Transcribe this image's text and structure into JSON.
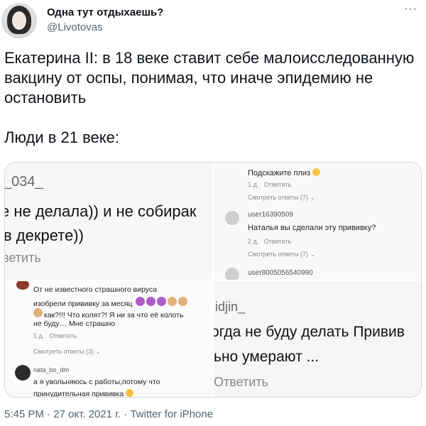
{
  "author": {
    "display_name": "Одна тут отдыхаешь?",
    "handle": "@Livotovas",
    "avatar_icon": "avatar-portrait"
  },
  "more_icon": "···",
  "tweet": {
    "paragraph1": "Екатерина II: в 18 веке ставит себе малоисследованную вакцину от оспы, понимая, что иначе эпидемию не остановить",
    "paragraph2": "Люди в 21 веке:"
  },
  "media": {
    "top_left": {
      "line1": "_034_",
      "line2": "е не делала)) и не собирак",
      "line3": "в декрете))",
      "line4": "ветить"
    },
    "top_right": {
      "comment1": "Подскажите плиз",
      "meta1_age": "1 д.",
      "meta1_reply": "Ответить",
      "view1": "Смотреть ответы (7)",
      "user2": "user16390509",
      "comment2": "Наталья вы сделали эту прививку?",
      "meta2_age": "2 д.",
      "meta2_reply": "Ответить",
      "view2": "Смотреть ответы (7)",
      "user3": "user8005056540990"
    },
    "bottom_left": {
      "line1": "От не известного страшного вируса",
      "line2": "изобрели прививку за месяц",
      "line3": "как?!!! Что колят?! Я ни за что её колоть",
      "line4": "не буду… Мне страшно",
      "meta_age": "1 д.",
      "meta_reply": "Ответить",
      "view": "Смотреть ответы (3)",
      "user2": "nata_bo_dm",
      "comment2a": "а я увольняюсь с работы,потому что",
      "comment2b": "принудительная прививка"
    },
    "bottom_right": {
      "line1": "idjin_",
      "line2": "огда не буду делать Привив",
      "line3": "ьно умерают ...",
      "line4": "Ответить"
    }
  },
  "footer": {
    "timestamp": "5:45 PM · 27 окт. 2021 г. · Twitter for iPhone"
  }
}
